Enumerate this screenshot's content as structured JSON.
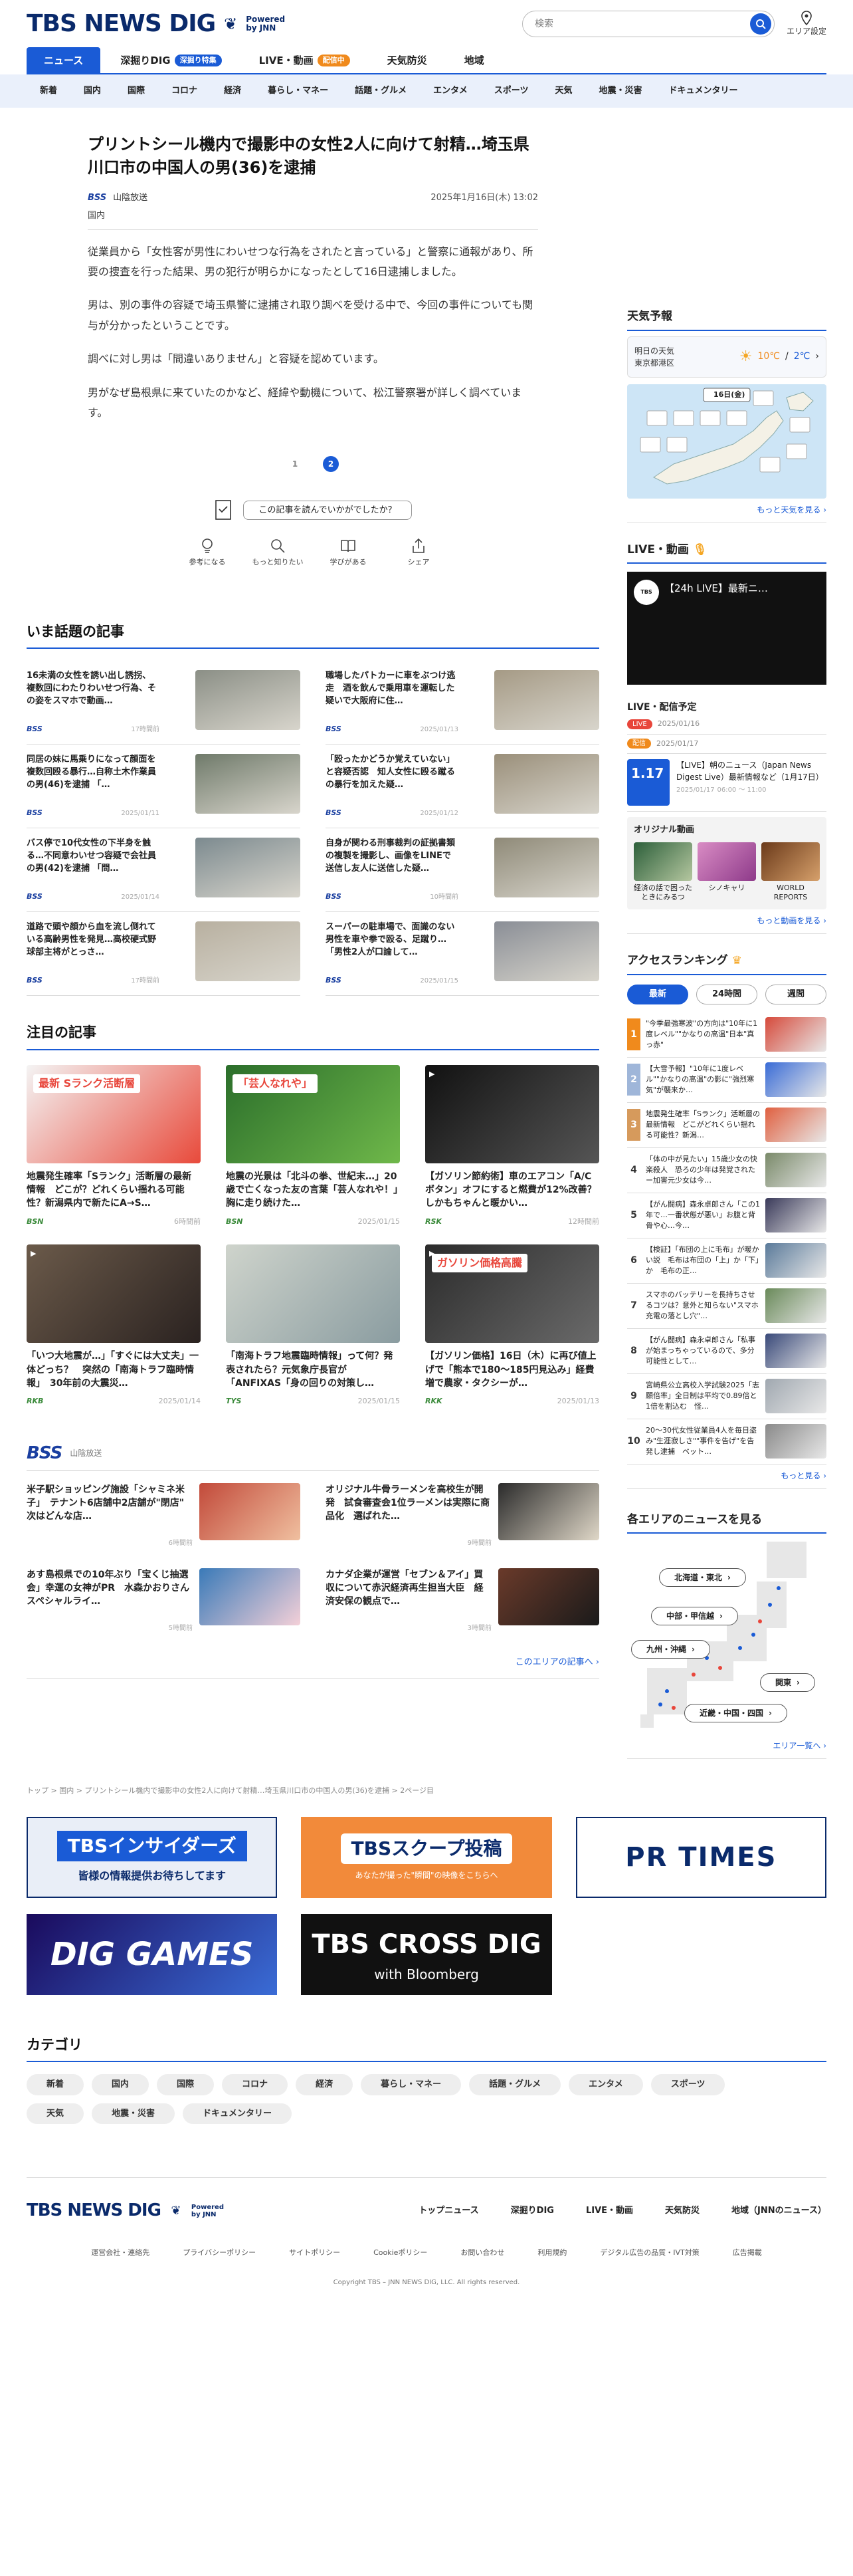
{
  "header": {
    "logo": "TBS NEWS DIG",
    "powered_by": "Powered",
    "jnn": "by JNN",
    "search_placeholder": "検索",
    "area_setting": "エリア設定"
  },
  "gnav": [
    {
      "label": "ニュース",
      "badge": ""
    },
    {
      "label": "深掘りDIG",
      "badge": "深掘り特集"
    },
    {
      "label": "LIVE・動画",
      "badge": "配信中"
    },
    {
      "label": "天気防災",
      "badge": ""
    },
    {
      "label": "地域",
      "badge": ""
    }
  ],
  "subnav": [
    "新着",
    "国内",
    "国際",
    "コロナ",
    "経済",
    "暮らし・マネー",
    "話題・グルメ",
    "エンタメ",
    "スポーツ",
    "天気",
    "地震・災害",
    "ドキュメンタリー"
  ],
  "article": {
    "title": "プリントシール機内で撮影中の女性2人に向けて射精…埼玉県川口市の中国人の男(36)を逮捕",
    "source_logo": "BSS",
    "source_name": "山陰放送",
    "date": "2025年1月16日(木) 13:02",
    "category": "国内",
    "paragraphs": [
      "従業員から「女性客が男性にわいせつな行為をされたと言っている」と警察に通報があり、所要の捜査を行った結果、男の犯行が明らかになったとして16日逮捕しました。",
      "男は、別の事件の容疑で埼玉県警に逮捕され取り調べを受ける中で、今回の事件についても関与が分かったということです。",
      "調べに対し男は「間違いありません」と容疑を認めています。",
      "男がなぜ島根県に来ていたのかなど、経緯や動機について、松江警察署が詳しく調べています。"
    ],
    "pages": [
      "1",
      "2"
    ],
    "feedback_q": "この記事を読んでいかがでしたか？",
    "feedback_btns": [
      "参考になる",
      "もっと知りたい",
      "学びがある",
      "シェア"
    ]
  },
  "hot": {
    "heading": "いま話題の記事",
    "items": [
      {
        "title": "16未満の女性を誘い出し誘拐、複数回にわたりわいせつ行為、その姿をスマホで動画…",
        "src": "BSS",
        "time": "17時間前"
      },
      {
        "title": "職場したパトカーに車をぶつけ逃走　酒を飲んで乗用車を運転した疑いで大阪府に住…",
        "src": "BSS",
        "time": "2025/01/13"
      },
      {
        "title": "同居の妹に馬乗りになって顔面を複数回殴る暴行…自称土木作業員の男(46)を逮捕 「…",
        "src": "BSS",
        "time": "2025/01/11"
      },
      {
        "title": "「殴ったかどうか覚えていない」と容疑否認　知人女性に殴る蹴るの暴行を加えた疑…",
        "src": "BSS",
        "time": "2025/01/12"
      },
      {
        "title": "バス停で10代女性の下半身を触る…不同意わいせつ容疑で会社員の男(42)を逮捕 「問…",
        "src": "BSS",
        "time": "2025/01/14"
      },
      {
        "title": "自身が関わる刑事裁判の証拠書類の複製を撮影し、画像をLINEで送信し友人に送信した疑…",
        "src": "BSS",
        "time": "10時間前"
      },
      {
        "title": "道路で頭や顔から血を流し倒れている高齢男性を発見…高校硬式野球部主将がとっさ…",
        "src": "BSS",
        "time": "17時間前"
      },
      {
        "title": "スーパーの駐車場で、面識のない男性を車や拳で殴る、足蹴り…「男性2人が口論して…",
        "src": "BSS",
        "time": "2025/01/15"
      }
    ]
  },
  "pick": {
    "heading": "注目の記事",
    "items": [
      {
        "title": "地震発生確率「Sランク」活断層の最新情報　どこが？どれくらい揺れる可能性？新潟県内で新たにA→S…",
        "src": "BSN",
        "time": "6時間前",
        "overlay": "最新 Sランク活断層"
      },
      {
        "title": "地震の光景は「北斗の拳、世紀末…」20歳で亡くなった友の言葉「芸人なれや！」胸に走り続けた…",
        "src": "BSN",
        "time": "2025/01/15",
        "overlay": "「芸人なれや」"
      },
      {
        "title": "【ガソリン節約術】車のエアコン「A/Cボタン」オフにすると燃費が12%改善？しかもちゃんと暖かい…",
        "src": "RSK",
        "time": "12時間前",
        "overlay": ""
      },
      {
        "title": "「いつ大地震が…」「すぐには大丈夫」一体どっち？　突然の「南海トラフ臨時情報」　30年前の大震災…",
        "src": "RKB",
        "time": "2025/01/14",
        "overlay": ""
      },
      {
        "title": "「南海トラフ地震臨時情報」って何？発表されたら？元気象庁長官が「ANFIXAS「身の回りの対策し…",
        "src": "TYS",
        "time": "2025/01/15",
        "overlay": ""
      },
      {
        "title": "【ガソリン価格】16日（木）に再び値上げで「熊本で180～185円見込み」経費増で農家・タクシーが…",
        "src": "RKK",
        "time": "2025/01/13",
        "overlay": "ガソリン価格高騰"
      }
    ]
  },
  "bss": {
    "logo": "BSS",
    "name": "山陰放送",
    "items": [
      {
        "title": "米子駅ショッピング施設「シャミネ米子」　テナント6店舗中2店舗が\"閉店\"　次はどんな店…",
        "time": "6時間前"
      },
      {
        "title": "オリジナル牛骨ラーメンを高校生が開発　試食審査会1位ラーメンは実際に商品化　選ばれた…",
        "time": "9時間前"
      },
      {
        "title": "あす島根県での10年ぶり「宝くじ抽選会」幸運の女神がPR　水森かおりさんスペシャルライ…",
        "time": "5時間前"
      },
      {
        "title": "カナダ企業が運営「セブン＆アイ」買収について赤沢経済再生担当大臣　経済安保の観点で…",
        "time": "3時間前"
      }
    ],
    "more": "このエリアの記事へ ›"
  },
  "weather": {
    "heading": "天気予報",
    "loc1": "明日の天気",
    "loc2": "東京都港区",
    "high": "10℃",
    "low": "2℃",
    "map_date": "16日(金)",
    "more": "もっと天気を見る ›"
  },
  "live": {
    "heading": "LIVE・動画",
    "title": "【24h LIVE】最新ニ…",
    "schedule_heading": "LIVE・配信予定",
    "schedule": [
      {
        "type": "LIVE",
        "date": "2025/01/16"
      },
      {
        "type": "配信",
        "date": "2025/01/17"
      }
    ],
    "card_title": "【LIVE】朝のニュース（Japan News Digest Live）最新情報など（1月17日）",
    "card_date": "2025/01/17",
    "card_time": "06:00 ～ 11:00",
    "card_thumb": "1.17",
    "orig_heading": "オリジナル動画",
    "orig": [
      "経済の話で困ったときにみるつ",
      "シノキャリ",
      "WORLD REPORTS"
    ],
    "more": "もっと動画を見る ›"
  },
  "ranking": {
    "heading": "アクセスランキング",
    "tabs": [
      "最新",
      "24時間",
      "週間"
    ],
    "items": [
      {
        "no": "1",
        "title": "\"今季最強寒波\"の方向は\"10年に1度レベル\"\"かなりの高温\"日本\"真っ赤\""
      },
      {
        "no": "2",
        "title": "【大雪予報】\"10年に1度レベル\"\"かなりの高温\"の影に\"強烈寒気\"が襲来か…"
      },
      {
        "no": "3",
        "title": "地震発生確率「Sランク」活断層の最新情報　どこがどれくらい揺れる可能性？新潟…"
      },
      {
        "no": "4",
        "title": "「体の中が見たい」15歳少女の快楽殺人　恐ろの少年は発覚されたー加害元少女は今…"
      },
      {
        "no": "5",
        "title": "【がん闘病】森永卓郎さん「この1年で…一番状態が悪い」お腹と背骨や心…今…"
      },
      {
        "no": "6",
        "title": "【検証】「布団の上に毛布」が暖かい説　毛布は布団の「上」か「下」か　毛布の正…"
      },
      {
        "no": "7",
        "title": "スマホのバッテリーを長持ちさせるコツは？意外と知らない\"スマホ充電の落とし穴\"…"
      },
      {
        "no": "8",
        "title": "【がん闘病】森永卓郎さん「私事が始まっちゃっているので、多分可能性として…"
      },
      {
        "no": "9",
        "title": "宮崎県公立高校入学試験2025「志願倍率」全日制は平均で0.89倍と1倍を割込む　怪…"
      },
      {
        "no": "10",
        "title": "20～30代女性従業員4人を毎日盗み\"生涯寂しさ\"\"事件を告げ\"を告発し逮捕　ベット…"
      }
    ],
    "more": "もっと見る ›"
  },
  "areas": {
    "heading": "各エリアのニュースを見る",
    "btns": [
      "北海道・東北",
      "中部・甲信越",
      "九州・沖縄",
      "関東",
      "近畿・中国・四国"
    ],
    "more": "エリア一覧へ ›"
  },
  "breadcrumb": "トップ > 国内 > プリントシール機内で撮影中の女性2人に向けて射精…埼玉県川口市の中国人の男(36)を逮捕 > 2ページ目",
  "banners": [
    {
      "title": "TBSインサイダーズ",
      "sub": "皆様の情報提供お待ちしてます"
    },
    {
      "title": "TBSスクープ投稿",
      "sub": "あなたが撮った\"瞬間\"の映像をこちらへ"
    },
    {
      "title": "PR TIMES",
      "sub": ""
    },
    {
      "title": "DIG GAMES",
      "sub": ""
    },
    {
      "title": "TBS CROSS DIG",
      "sub": "with Bloomberg"
    }
  ],
  "cats": {
    "heading": "カテゴリ",
    "items": [
      "新着",
      "国内",
      "国際",
      "コロナ",
      "経済",
      "暮らし・マネー",
      "話題・グルメ",
      "エンタメ",
      "スポーツ",
      "天気",
      "地震・災害",
      "ドキュメンタリー"
    ]
  },
  "footer": {
    "nav": [
      "トップニュース",
      "深掘りDIG",
      "LIVE・動画",
      "天気防災",
      "地域（JNNのニュース）"
    ],
    "links": [
      "運営会社・連絡先",
      "プライバシーポリシー",
      "サイトポリシー",
      "Cookieポリシー",
      "お問い合わせ",
      "利用規約",
      "デジタル広告の品質・IVT対策",
      "広告掲載"
    ],
    "copyright": "Copyright TBS – JNN NEWS DIG, LLC. All rights reserved."
  }
}
